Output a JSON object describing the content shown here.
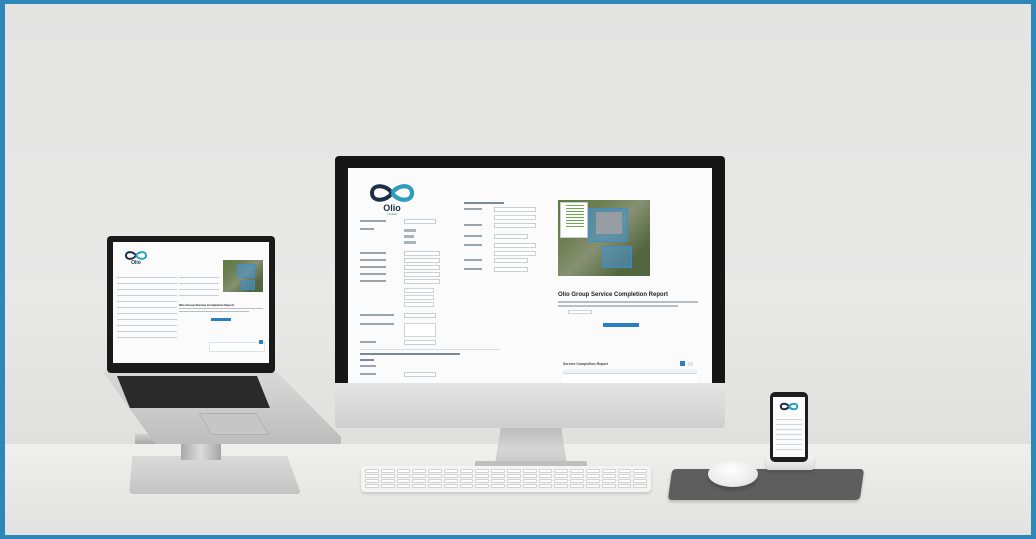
{
  "brand": {
    "name": "Olio",
    "subtitle": "Limited",
    "accent_color": "#2a9fc0",
    "dark_color": "#1c2f45"
  },
  "imac": {
    "report_title": "Olio Group Service Completion Report",
    "table_title": "Service Completion Report"
  },
  "laptop": {
    "report_title": "Olio Group Service Completion Report"
  },
  "colors": {
    "border_frame": "#2f86b8",
    "button_blue": "#2a7fc1"
  }
}
